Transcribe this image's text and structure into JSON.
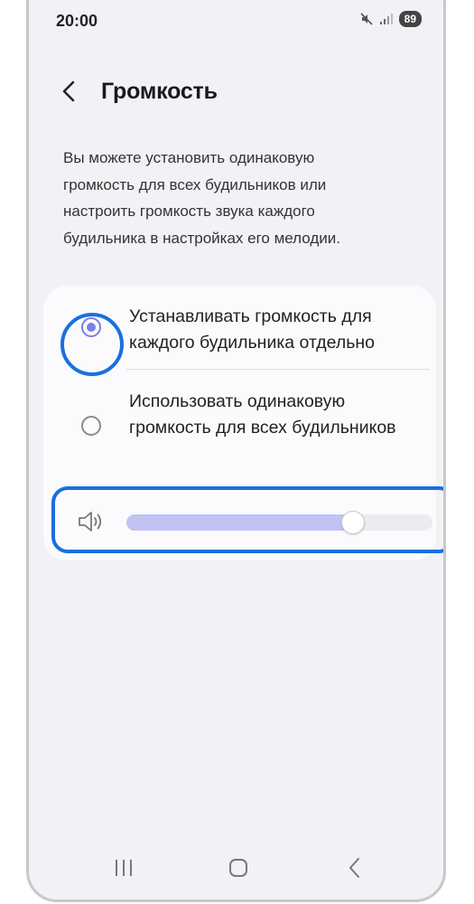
{
  "status_bar": {
    "time": "20:00",
    "battery": "89",
    "icons": [
      "mute-icon",
      "signal-icon",
      "battery-icon"
    ]
  },
  "header": {
    "back_icon": "chevron-left-icon",
    "title": "Громкость"
  },
  "description": "Вы можете установить одинаковую громкость для всех будильников или настроить громкость звука каждого будильника в настройках его мелодии.",
  "options": [
    {
      "label": "Устанавливать громкость для каждого будильника отдельно",
      "selected": true
    },
    {
      "label": "Использовать одинаковую громкость для всех будильников",
      "selected": false
    }
  ],
  "volume": {
    "icon": "speaker-icon",
    "level": 0.74
  },
  "navigation": {
    "icons": [
      "recent-apps-icon",
      "home-icon",
      "back-icon"
    ]
  },
  "colors": {
    "accent": "#7b7fe8",
    "highlight": "#1a6fde",
    "slider_fill": "#c2c3f3"
  }
}
